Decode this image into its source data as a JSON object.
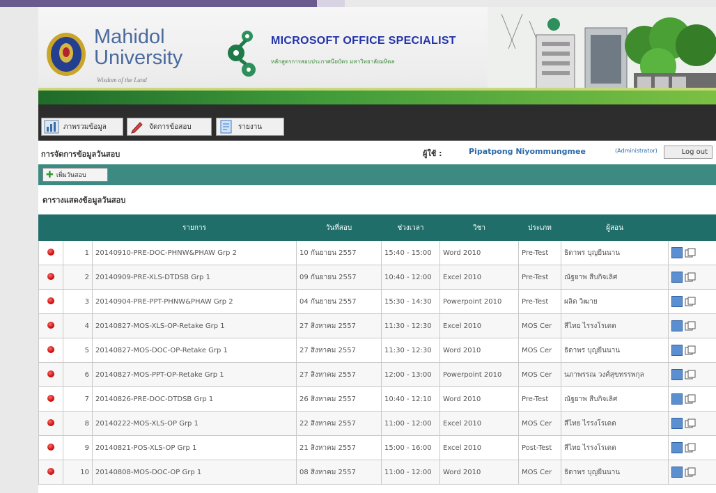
{
  "header": {
    "university_name": "Mahidol\nUniversity",
    "university_motto": "Wisdom of the Land",
    "program_title": "MICROSOFT OFFICE SPECIALIST",
    "program_subtitle": "หลักสูตรการสอบประกาศนียบัตร มหาวิทยาลัยมหิดล"
  },
  "menu": {
    "items": [
      {
        "label": "ภาพรวมข้อมูล",
        "icon": "chart-icon"
      },
      {
        "label": "จัดการข้อสอบ",
        "icon": "pencil-icon"
      },
      {
        "label": "รายงาน",
        "icon": "report-icon"
      }
    ]
  },
  "titlebar": {
    "page_title": "การจัดการข้อมูลวันสอบ",
    "user_label": "ผู้ใช้ :",
    "user_name": "Pipatpong Niyommungmee",
    "user_role": "(Administrator)",
    "logout_label": "Log out"
  },
  "toolbar": {
    "add_label": "เพิ่มวันสอบ"
  },
  "section_title": "ตารางแสดงข้อมูลวันสอบ",
  "table": {
    "columns": [
      "",
      "",
      "รายการ",
      "วันที่สอบ",
      "ช่วงเวลา",
      "วิชา",
      "ประเภท",
      "ผู้สอน",
      ""
    ],
    "rows": [
      {
        "no": "1",
        "name": "20140910-PRE-DOC-PHNW&PHAW Grp 2",
        "date": "10 กันยายน 2557",
        "time": "15:40 - 15:00",
        "subject": "Word 2010",
        "type": "Pre-Test",
        "teacher": "ธิดาพร บุญยืนนาน"
      },
      {
        "no": "2",
        "name": "20140909-PRE-XLS-DTDSB Grp 1",
        "date": "09 กันยายน 2557",
        "time": "10:40 - 12:00",
        "subject": "Excel 2010",
        "type": "Pre-Test",
        "teacher": "ณัฐยาพ สืบกิจเลิศ"
      },
      {
        "no": "3",
        "name": "20140904-PRE-PPT-PHNW&PHAW Grp 2",
        "date": "04 กันยายน 2557",
        "time": "15:30 - 14:30",
        "subject": "Powerpoint 2010",
        "type": "Pre-Test",
        "teacher": "ผลิต วิฒาย"
      },
      {
        "no": "4",
        "name": "20140827-MOS-XLS-OP-Retake Grp 1",
        "date": "27 สิงหาคม 2557",
        "time": "11:30 - 12:30",
        "subject": "Excel 2010",
        "type": "MOS Cer",
        "teacher": "สีไทย ไรรงโรเดต"
      },
      {
        "no": "5",
        "name": "20140827-MOS-DOC-OP-Retake Grp 1",
        "date": "27 สิงหาคม 2557",
        "time": "11:30 - 12:30",
        "subject": "Word 2010",
        "type": "MOS Cer",
        "teacher": "ธิดาพร บุญยืนนาน"
      },
      {
        "no": "6",
        "name": "20140827-MOS-PPT-OP-Retake Grp 1",
        "date": "27 สิงหาคม 2557",
        "time": "12:00 - 13:00",
        "subject": "Powerpoint 2010",
        "type": "MOS Cer",
        "teacher": "นภาพรรณ วงศ์สุขทรรพกุล"
      },
      {
        "no": "7",
        "name": "20140826-PRE-DOC-DTDSB Grp 1",
        "date": "26 สิงหาคม 2557",
        "time": "10:40 - 12:10",
        "subject": "Word 2010",
        "type": "Pre-Test",
        "teacher": "ณัฐยาพ สืบกิจเลิศ"
      },
      {
        "no": "8",
        "name": "20140222-MOS-XLS-OP Grp 1",
        "date": "22 สิงหาคม 2557",
        "time": "11:00 - 12:00",
        "subject": "Excel 2010",
        "type": "MOS Cer",
        "teacher": "สีไทย ไรรงโรเดต"
      },
      {
        "no": "9",
        "name": "20140821-POS-XLS-OP Grp 1",
        "date": "21 สิงหาคม 2557",
        "time": "15:00 - 16:00",
        "subject": "Excel 2010",
        "type": "Post-Test",
        "teacher": "สีไทย ไรรงโรเดต"
      },
      {
        "no": "10",
        "name": "20140808-MOS-DOC-OP Grp 1",
        "date": "08 สิงหาคม 2557",
        "time": "11:00 - 12:00",
        "subject": "Word 2010",
        "type": "MOS Cer",
        "teacher": "ธิดาพร บุญยืนนาน"
      }
    ]
  },
  "colors": {
    "menubar": "#2d2d2d",
    "toolbar": "#3d8a82",
    "table_header": "#1f6e6a",
    "user_name": "#2b6aa8",
    "status_dot": "#c40000"
  }
}
